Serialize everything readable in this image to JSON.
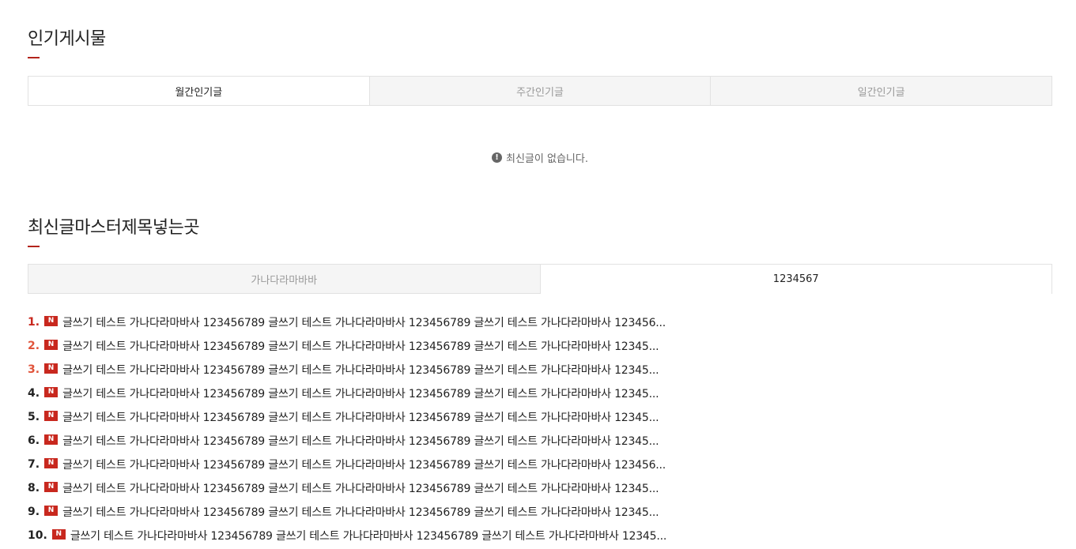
{
  "popular": {
    "title": "인기게시물",
    "tabs": [
      {
        "label": "월간인기글",
        "active": true
      },
      {
        "label": "주간인기글",
        "active": false
      },
      {
        "label": "일간인기글",
        "active": false
      }
    ],
    "empty_message": "최신글이 없습니다.",
    "empty_icon": "!"
  },
  "latest": {
    "title": "최신글마스터제목넣는곳",
    "tabs": [
      {
        "label": "가나다라마바바",
        "active": false
      },
      {
        "label": "1234567",
        "active": true
      }
    ],
    "new_badge": "N",
    "items": [
      {
        "rank": "1.",
        "text": "글쓰기 테스트 가나다라마바사 123456789 글쓰기 테스트 가나다라마바사 123456789 글쓰기 테스트 가나다라마바사 123456..."
      },
      {
        "rank": "2.",
        "text": "글쓰기 테스트 가나다라마바사 123456789 글쓰기 테스트 가나다라마바사 123456789 글쓰기 테스트 가나다라마바사 12345..."
      },
      {
        "rank": "3.",
        "text": "글쓰기 테스트 가나다라마바사 123456789 글쓰기 테스트 가나다라마바사 123456789 글쓰기 테스트 가나다라마바사 12345..."
      },
      {
        "rank": "4.",
        "text": "글쓰기 테스트 가나다라마바사 123456789 글쓰기 테스트 가나다라마바사 123456789 글쓰기 테스트 가나다라마바사 12345..."
      },
      {
        "rank": "5.",
        "text": "글쓰기 테스트 가나다라마바사 123456789 글쓰기 테스트 가나다라마바사 123456789 글쓰기 테스트 가나다라마바사 12345..."
      },
      {
        "rank": "6.",
        "text": "글쓰기 테스트 가나다라마바사 123456789 글쓰기 테스트 가나다라마바사 123456789 글쓰기 테스트 가나다라마바사 12345..."
      },
      {
        "rank": "7.",
        "text": "글쓰기 테스트 가나다라마바사 123456789 글쓰기 테스트 가나다라마바사 123456789 글쓰기 테스트 가나다라마바사 123456..."
      },
      {
        "rank": "8.",
        "text": "글쓰기 테스트 가나다라마바사 123456789 글쓰기 테스트 가나다라마바사 123456789 글쓰기 테스트 가나다라마바사 12345..."
      },
      {
        "rank": "9.",
        "text": "글쓰기 테스트 가나다라마바사 123456789 글쓰기 테스트 가나다라마바사 123456789 글쓰기 테스트 가나다라마바사 12345..."
      },
      {
        "rank": "10.",
        "text": "글쓰기 테스트 가나다라마바사 123456789 글쓰기 테스트 가나다라마바사 123456789 글쓰기 테스트 가나다라마바사 12345..."
      }
    ]
  },
  "colors": {
    "accent": "#b3241b",
    "rank_top": "#c8281e",
    "rank_hot": "#e0533a",
    "tab_inactive_bg": "#f5f5f5"
  }
}
